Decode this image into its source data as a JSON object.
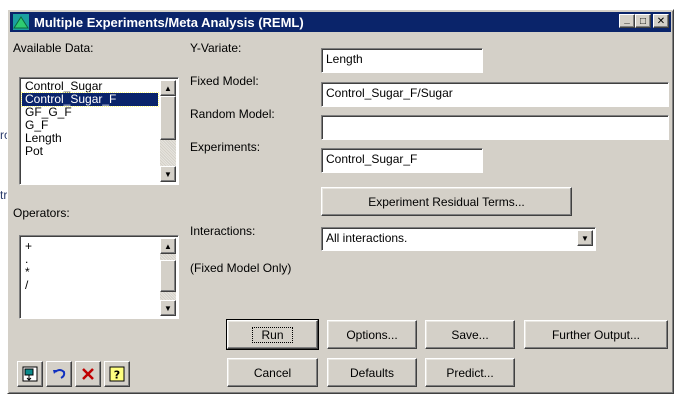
{
  "window": {
    "title": "Multiple Experiments/Meta Analysis (REML)",
    "minimize_glyph": "_",
    "maximize_glyph": "□",
    "close_glyph": "✕"
  },
  "background_fragments": [
    "rc",
    "tr"
  ],
  "available_data": {
    "label": "Available Data:",
    "items": [
      "Control_Sugar",
      "Control_Sugar_F",
      "GF_G_F",
      "G_F",
      "Length",
      "Pot"
    ],
    "selected": "Control_Sugar_F"
  },
  "operators": {
    "label": "Operators:",
    "items": [
      "+",
      ".",
      "*",
      "/"
    ]
  },
  "fields": {
    "y_variate": {
      "label": "Y-Variate:",
      "value": "Length"
    },
    "fixed_model": {
      "label": "Fixed Model:",
      "value": "Control_Sugar_F/Sugar"
    },
    "random_model": {
      "label": "Random Model:",
      "value": ""
    },
    "experiments": {
      "label": "Experiments:",
      "value": "Control_Sugar_F"
    }
  },
  "experiment_residual_button": "Experiment Residual Terms...",
  "interactions": {
    "label": "Interactions:",
    "value": "All interactions.",
    "note": "(Fixed Model Only)"
  },
  "buttons": {
    "run": "Run",
    "options": "Options...",
    "save": "Save...",
    "further_output": "Further Output...",
    "cancel": "Cancel",
    "defaults": "Defaults",
    "predict": "Predict..."
  },
  "icon_buttons": [
    "copy-icon",
    "undo-icon",
    "clear-icon",
    "help-icon"
  ],
  "colors": {
    "titlebar": "#0a246a",
    "face": "#d4d0c8",
    "selection": "#0a246a",
    "clear_icon": "#c00000"
  }
}
